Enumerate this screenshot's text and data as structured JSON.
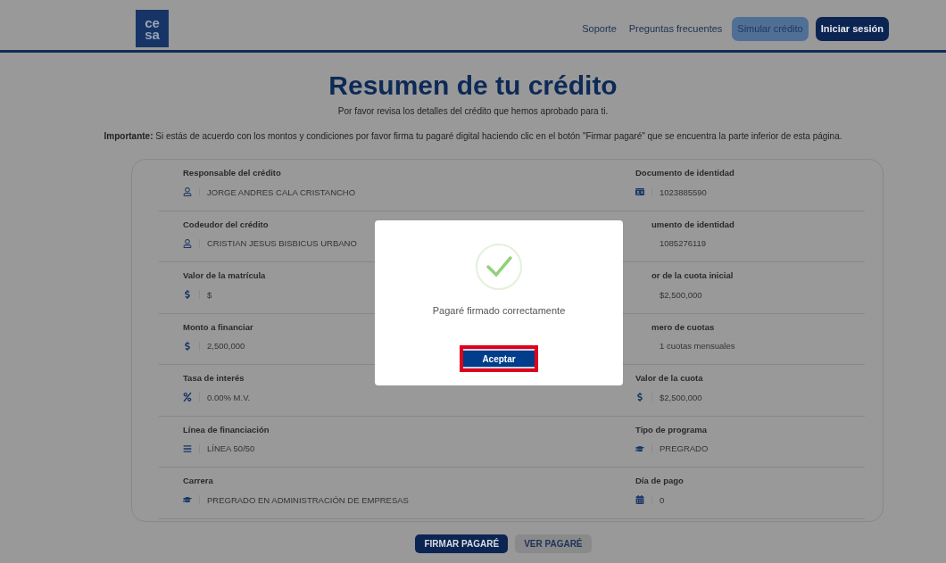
{
  "header": {
    "logo": [
      "ce",
      "sa"
    ],
    "nav": [
      {
        "label": "Soporte",
        "kind": "link"
      },
      {
        "label": "Preguntas frecuentes",
        "kind": "link"
      },
      {
        "label": "Simular crédito",
        "kind": "light"
      },
      {
        "label": "Iniciar sesión",
        "kind": "dark"
      }
    ]
  },
  "title": "Resumen de tu crédito",
  "subtitle": "Por favor revisa los detalles del crédito que hemos aprobado para ti.",
  "notice": "**Importante:** Si estás de acuerdo con los montos y condiciones por favor firma tu pagaré digital haciendo clic en el botón \"Firmar pagaré\" que se encuentra la parte inferior de esta página.",
  "rows": [
    [
      {
        "label": "Responsable del crédito",
        "value": "JORGE ANDRES CALA CRISTANCHO",
        "kind": "person",
        "covered": false
      },
      {
        "label": "Documento de identidad",
        "value": "1023885590",
        "kind": "id",
        "covered": false
      }
    ],
    [
      {
        "label": "Codeudor del crédito",
        "value": "CRISTIAN JESUS BISBICUS URBANO",
        "kind": "person",
        "covered": false
      },
      {
        "label": "umento de identidad",
        "value": "1085276119",
        "kind": "id",
        "covered": true
      }
    ],
    [
      {
        "label": "Valor de la matrícula",
        "value": "$",
        "kind": "money",
        "covered": false
      },
      {
        "label": "or de la cuota inicial",
        "value": "$2,500,000",
        "kind": "money",
        "covered": true
      }
    ],
    [
      {
        "label": "Monto a financiar",
        "value": "2,500,000",
        "kind": "money",
        "covered": false
      },
      {
        "label": "mero de cuotas",
        "value": "1 cuotas mensuales",
        "kind": "list",
        "covered": true
      }
    ],
    [
      {
        "label": "Tasa de interés",
        "value": "0.00% M.V.",
        "kind": "rate",
        "covered": false
      },
      {
        "label": "Valor de la cuota",
        "value": "$2,500,000",
        "kind": "money",
        "covered": false
      }
    ],
    [
      {
        "label": "Línea de financiación",
        "value": "LÍNEA 50/50",
        "kind": "list",
        "covered": false
      },
      {
        "label": "Tipo de programa",
        "value": "PREGRADO",
        "kind": "program",
        "covered": false
      }
    ],
    [
      {
        "label": "Carrera",
        "value": "PREGRADO EN ADMINISTRACIÓN DE EMPRESAS",
        "kind": "program",
        "covered": false
      },
      {
        "label": "Día de pago",
        "value": "0",
        "kind": "date",
        "covered": false
      }
    ]
  ],
  "actions": [
    {
      "label": "FIRMAR PAGARÉ",
      "kind": "primary"
    },
    {
      "label": "VER PAGARÉ",
      "kind": "secondary"
    }
  ],
  "modal": {
    "message": "Pagaré firmado correctamente",
    "button": {
      "label": "Aceptar",
      "highlighted": true
    }
  }
}
